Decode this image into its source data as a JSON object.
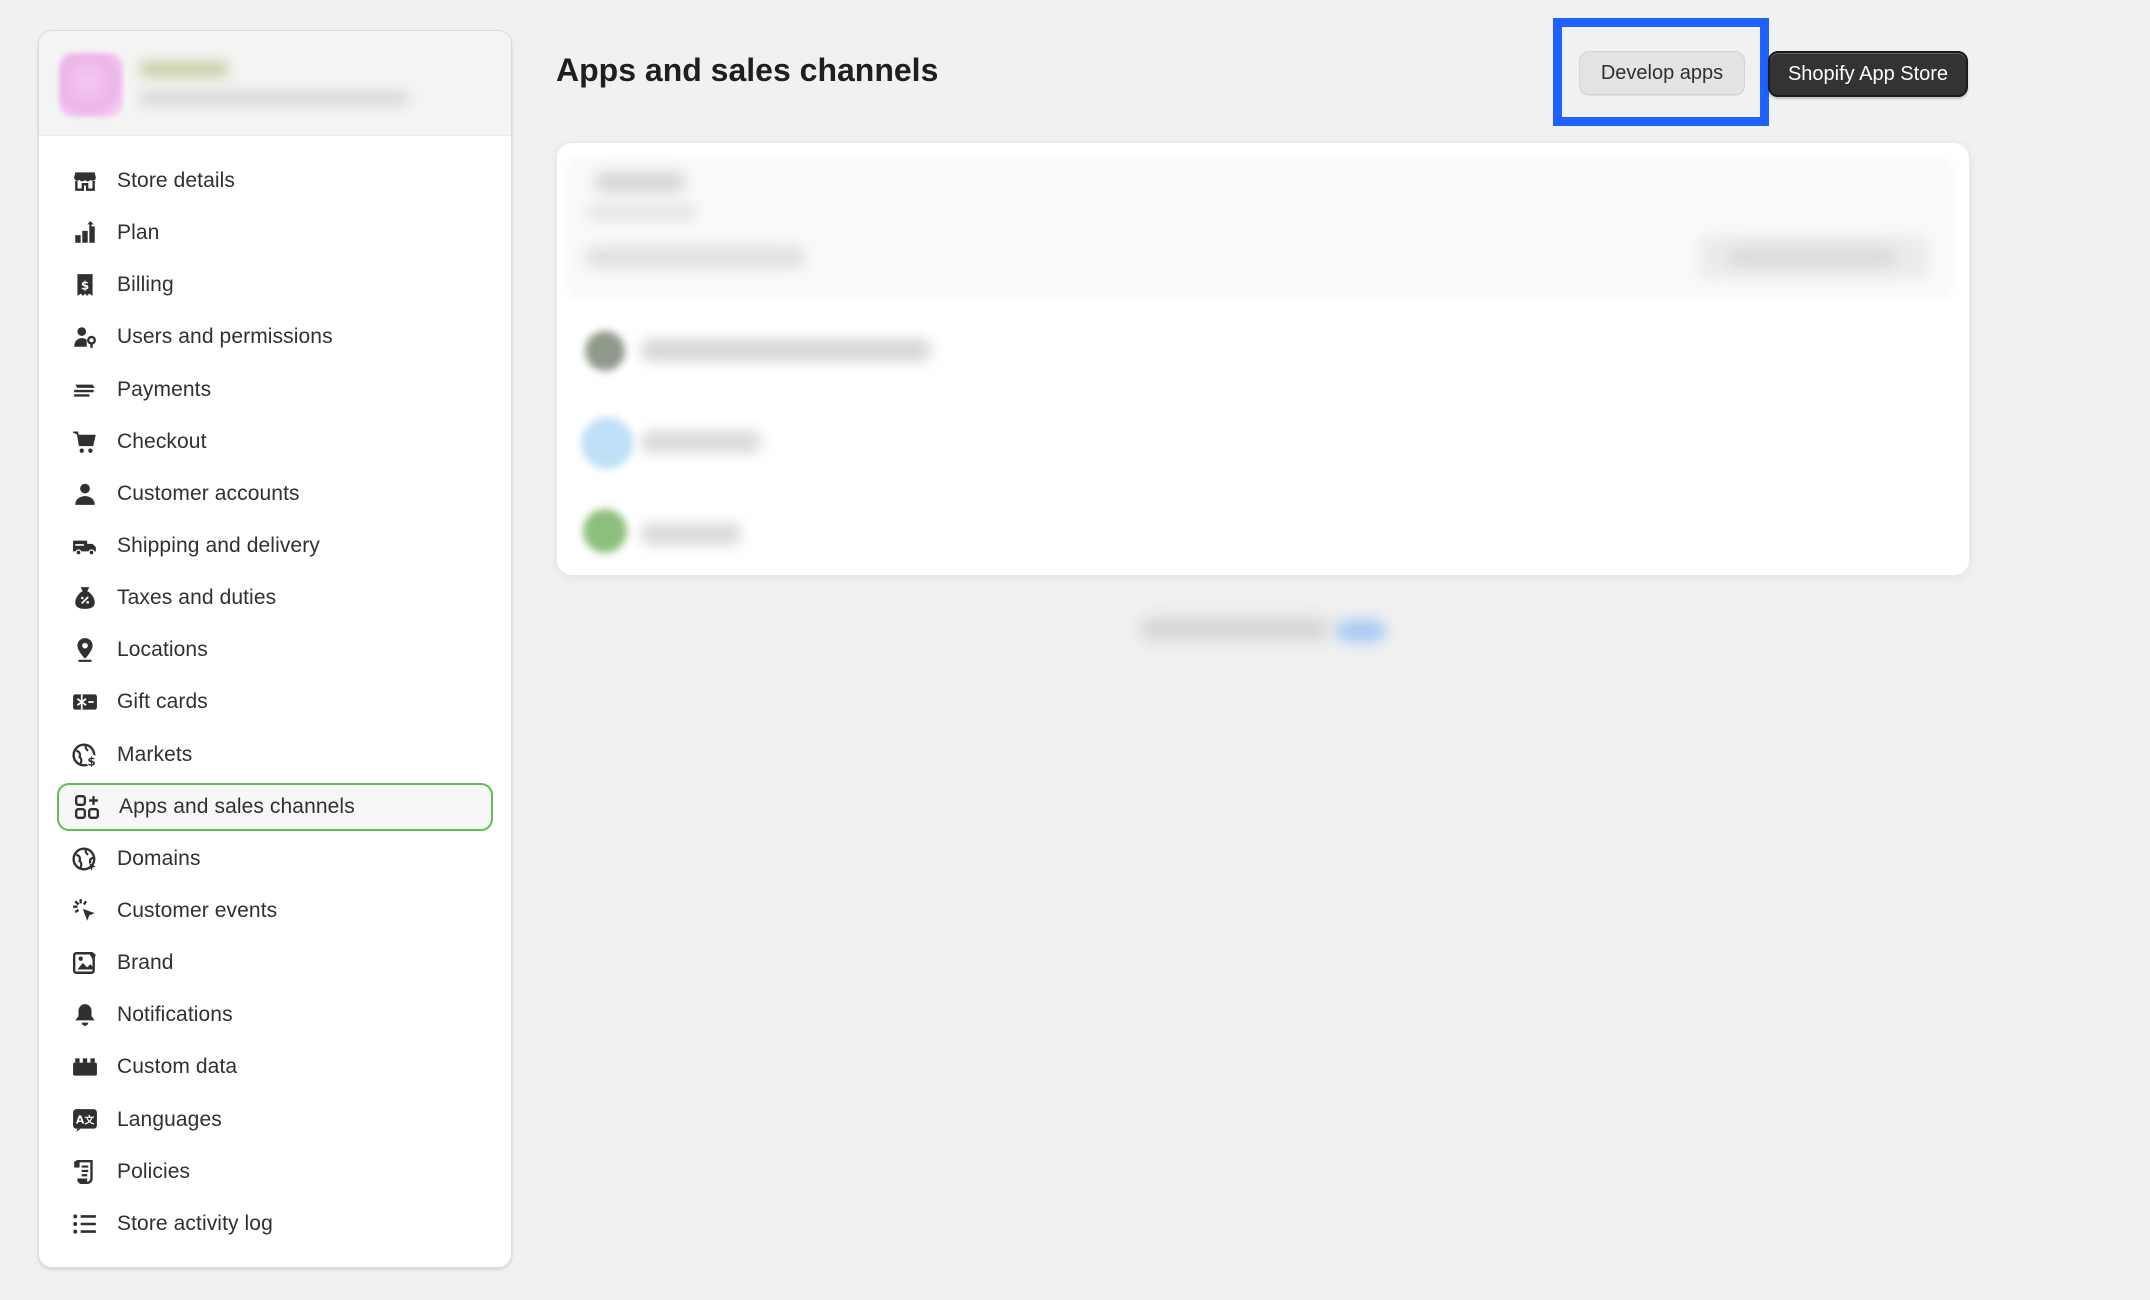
{
  "sidebar": {
    "items": [
      {
        "label": "Store details",
        "icon": "store-icon"
      },
      {
        "label": "Plan",
        "icon": "plan-icon"
      },
      {
        "label": "Billing",
        "icon": "billing-icon"
      },
      {
        "label": "Users and permissions",
        "icon": "users-icon"
      },
      {
        "label": "Payments",
        "icon": "payments-icon"
      },
      {
        "label": "Checkout",
        "icon": "cart-icon"
      },
      {
        "label": "Customer accounts",
        "icon": "person-icon"
      },
      {
        "label": "Shipping and delivery",
        "icon": "truck-icon"
      },
      {
        "label": "Taxes and duties",
        "icon": "tax-bag-icon"
      },
      {
        "label": "Locations",
        "icon": "location-pin-icon"
      },
      {
        "label": "Gift cards",
        "icon": "gift-card-icon"
      },
      {
        "label": "Markets",
        "icon": "globe-dollar-icon"
      },
      {
        "label": "Apps and sales channels",
        "icon": "apps-grid-icon",
        "active": true
      },
      {
        "label": "Domains",
        "icon": "globe-icon"
      },
      {
        "label": "Customer events",
        "icon": "cursor-click-icon"
      },
      {
        "label": "Brand",
        "icon": "brand-image-icon"
      },
      {
        "label": "Notifications",
        "icon": "bell-icon"
      },
      {
        "label": "Custom data",
        "icon": "database-icon"
      },
      {
        "label": "Languages",
        "icon": "translate-icon"
      },
      {
        "label": "Policies",
        "icon": "policy-scroll-icon"
      },
      {
        "label": "Store activity log",
        "icon": "list-icon"
      }
    ]
  },
  "header": {
    "title": "Apps and sales channels",
    "develop_apps_label": "Develop apps",
    "app_store_label": "Shopify App Store"
  },
  "colors": {
    "highlight": "#1f62ff",
    "active_border": "#5cbf4e",
    "primary_button": "#333333"
  }
}
